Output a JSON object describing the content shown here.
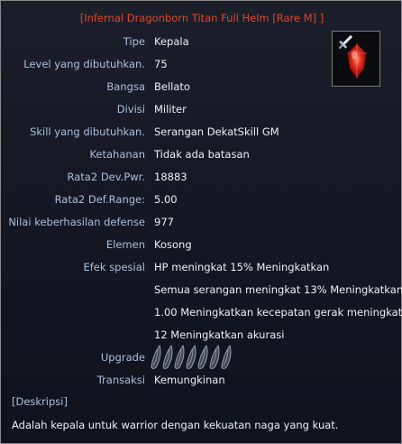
{
  "item": {
    "title": "[Infernal Dragonborn Titan Full Helm [Rare M] ]",
    "icon": "red-gem-sword-icon",
    "colors": {
      "title": "#e0472a",
      "label": "#a9c0de",
      "value": "#eef0f3",
      "gem": "#e0271c"
    }
  },
  "stats": [
    {
      "label": "Tipe",
      "value": "Kepala"
    },
    {
      "label": "Level yang dibutuhkan.",
      "value": "75"
    },
    {
      "label": "Bangsa",
      "value": "Bellato"
    },
    {
      "label": "Divisi",
      "value": "Militer"
    },
    {
      "label": "Skill yang dibutuhkan.",
      "value": "Serangan DekatSkill GM"
    },
    {
      "label": "Ketahanan",
      "value": "Tidak ada batasan"
    },
    {
      "label": "Rata2 Dev.Pwr.",
      "value": "18883"
    },
    {
      "label": "Rata2 Def.Range:",
      "value": "5.00"
    },
    {
      "label": "Nilai keberhasilan defense",
      "value": "977"
    },
    {
      "label": "Elemen",
      "value": "Kosong"
    },
    {
      "label": "Efek spesial",
      "value": "HP meningkat 15% Meningkatkan"
    }
  ],
  "effects_continued": [
    "Semua serangan meningkat 13% Meningkatkan",
    "1.00 Meningkatkan kecepatan gerak meningkat.",
    "12 Meningkatkan akurasi"
  ],
  "upgrade": {
    "label": "Upgrade",
    "slots_total": 7,
    "slots_filled": 0,
    "slot_icon": "empty-talic-slot-icon"
  },
  "transaction": {
    "label": "Transaksi",
    "value": "Kemungkinan"
  },
  "description": {
    "heading": "[Deskripsi]",
    "text": "Adalah kepala untuk warrior dengan kekuatan naga yang kuat."
  }
}
